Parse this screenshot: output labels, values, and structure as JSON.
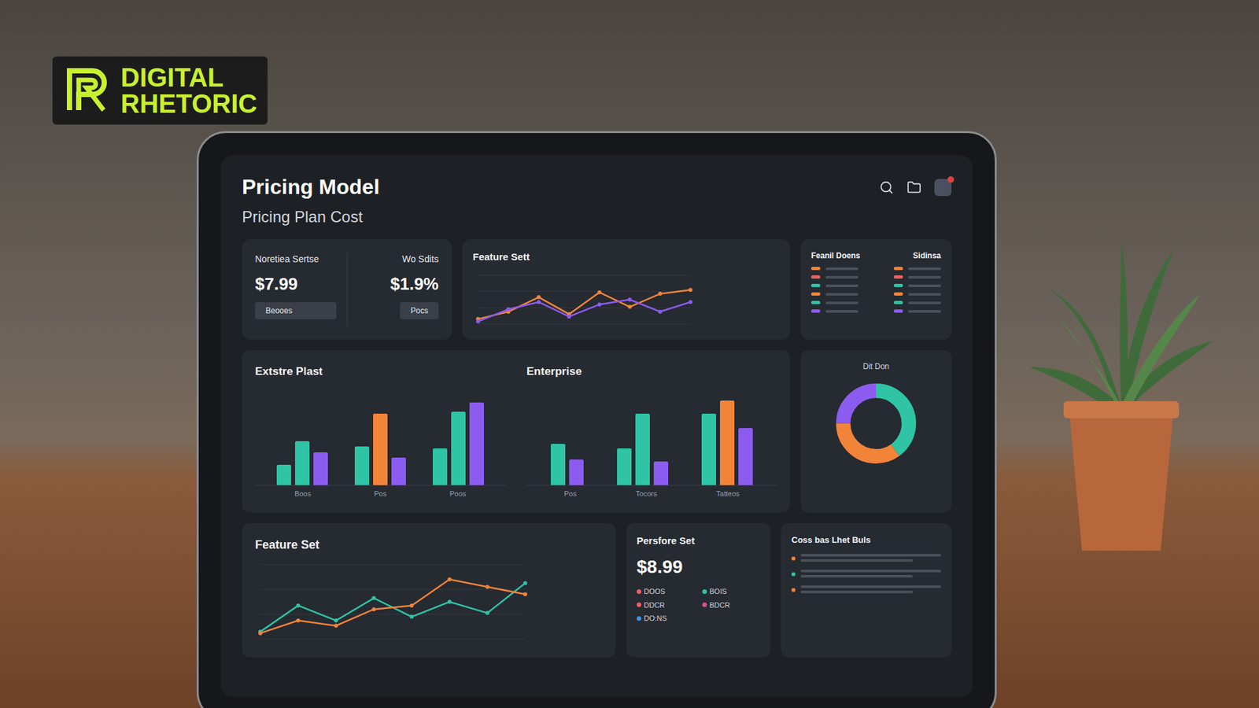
{
  "logo": {
    "line1": "DIGITAL",
    "line2": "RHETORIC"
  },
  "header": {
    "title": "Pricing Model",
    "subtitle": "Pricing Plan Cost",
    "notification": true
  },
  "price_card": {
    "items": [
      {
        "label": "Noretiea Sertse",
        "value": "$7.99",
        "button": "Beooes"
      },
      {
        "label": "Wo Sdits",
        "value": "$1.9%",
        "button": "Pocs"
      }
    ]
  },
  "top_chart": {
    "title": "Feature Sett",
    "series": [
      {
        "color": "#f2843a",
        "values": [
          10,
          25,
          55,
          20,
          65,
          35,
          62,
          70
        ]
      },
      {
        "color": "#8c5cf0",
        "values": [
          5,
          30,
          45,
          15,
          40,
          50,
          25,
          45
        ]
      }
    ]
  },
  "table_card": {
    "columns": [
      "Feanil Doens",
      "Sidinsa"
    ],
    "rows": [
      {
        "color": "#f2843a"
      },
      {
        "color": "#f06060"
      },
      {
        "color": "#2ec4a5"
      },
      {
        "color": "#f2843a"
      },
      {
        "color": "#2ec4a5"
      },
      {
        "color": "#8c5cf0"
      }
    ]
  },
  "bar_charts": [
    {
      "title": "Extstre Plast",
      "groups": [
        {
          "label": "Boos",
          "bars": [
            {
              "value": 22,
              "color": "#2ec4a5"
            },
            {
              "value": 48,
              "color": "#2ec4a5"
            },
            {
              "value": 36,
              "color": "#8c5cf0"
            }
          ]
        },
        {
          "label": "Pos",
          "bars": [
            {
              "value": 42,
              "color": "#2ec4a5"
            },
            {
              "value": 78,
              "color": "#f2843a"
            },
            {
              "value": 30,
              "color": "#8c5cf0"
            }
          ]
        },
        {
          "label": "Poos",
          "bars": [
            {
              "value": 40,
              "color": "#2ec4a5"
            },
            {
              "value": 80,
              "color": "#2ec4a5"
            },
            {
              "value": 90,
              "color": "#8c5cf0"
            }
          ]
        }
      ]
    },
    {
      "title": "Enterprise",
      "groups": [
        {
          "label": "Pos",
          "bars": [
            {
              "value": 45,
              "color": "#2ec4a5"
            },
            {
              "value": 28,
              "color": "#8c5cf0"
            }
          ]
        },
        {
          "label": "Tocors",
          "bars": [
            {
              "value": 40,
              "color": "#2ec4a5"
            },
            {
              "value": 78,
              "color": "#2ec4a5"
            },
            {
              "value": 26,
              "color": "#8c5cf0"
            }
          ]
        },
        {
          "label": "Tatteos",
          "bars": [
            {
              "value": 78,
              "color": "#2ec4a5"
            },
            {
              "value": 92,
              "color": "#f2843a"
            },
            {
              "value": 62,
              "color": "#8c5cf0"
            }
          ]
        }
      ]
    }
  ],
  "donut": {
    "title": "Dit Don",
    "segments": [
      {
        "value": 40,
        "color": "#2ec4a5"
      },
      {
        "value": 35,
        "color": "#f2843a"
      },
      {
        "value": 25,
        "color": "#8c5cf0"
      }
    ]
  },
  "line_chart": {
    "title": "Feature Set",
    "series": [
      {
        "color": "#2ec4a5",
        "values": [
          10,
          45,
          25,
          55,
          30,
          50,
          35,
          75
        ]
      },
      {
        "color": "#f2843a",
        "values": [
          8,
          25,
          18,
          40,
          45,
          80,
          70,
          60
        ]
      }
    ]
  },
  "plan_card": {
    "title": "Persfore Set",
    "price": "$8.99",
    "legend": [
      {
        "label": "DOOS",
        "color": "#f06060"
      },
      {
        "label": "BOIS",
        "color": "#2ec4a5"
      },
      {
        "label": "DDCR",
        "color": "#f06060"
      },
      {
        "label": "BDCR",
        "color": "#e0508a"
      },
      {
        "label": "DO:NS",
        "color": "#4a90e2"
      }
    ]
  },
  "notes_card": {
    "title": "Coss bas Lhet Buls",
    "items": [
      {
        "color": "#f2843a"
      },
      {
        "color": "#2ec4a5"
      },
      {
        "color": "#f2843a"
      }
    ]
  }
}
